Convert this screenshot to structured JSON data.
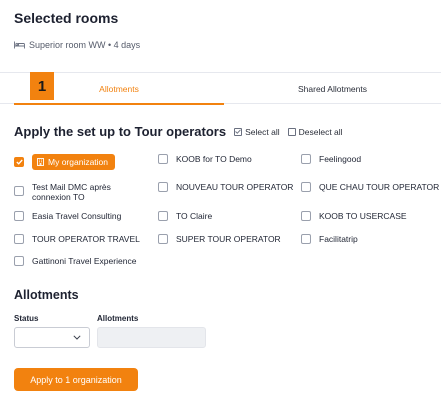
{
  "page": {
    "title": "Selected rooms"
  },
  "room": {
    "summary": "Superior room WW • 4 days",
    "icon": "bed-icon"
  },
  "step": {
    "number": "1"
  },
  "tabs": [
    {
      "label": "Allotments",
      "active": true
    },
    {
      "label": "Shared Allotments",
      "active": false
    }
  ],
  "apply_section": {
    "title": "Apply the set up to Tour operators",
    "select_all": "Select all",
    "deselect_all": "Deselect all"
  },
  "operators": [
    {
      "label": "My organization",
      "checked": true,
      "highlight": true
    },
    {
      "label": "KOOB for TO Demo",
      "checked": false
    },
    {
      "label": "Feelingood",
      "checked": false
    },
    {
      "label": "Test Mail DMC après connexion TO",
      "checked": false
    },
    {
      "label": "NOUVEAU TOUR OPERATOR",
      "checked": false
    },
    {
      "label": "QUE CHAU TOUR OPERATOR",
      "checked": false
    },
    {
      "label": "Easia Travel Consulting",
      "checked": false
    },
    {
      "label": "TO Claire",
      "checked": false
    },
    {
      "label": "KOOB TO USERCASE",
      "checked": false
    },
    {
      "label": "TOUR OPERATOR TRAVEL",
      "checked": false
    },
    {
      "label": "SUPER TOUR OPERATOR",
      "checked": false
    },
    {
      "label": "Facilitatrip",
      "checked": false
    },
    {
      "label": "Gattinoni Travel Experience",
      "checked": false
    }
  ],
  "allotments": {
    "title": "Allotments",
    "status_label": "Status",
    "status_value": "",
    "allotments_label": "Allotments",
    "allotments_value": ""
  },
  "apply_button": {
    "label": "Apply to 1 organization"
  },
  "colors": {
    "accent": "#f2820f",
    "text": "#1d2130"
  }
}
